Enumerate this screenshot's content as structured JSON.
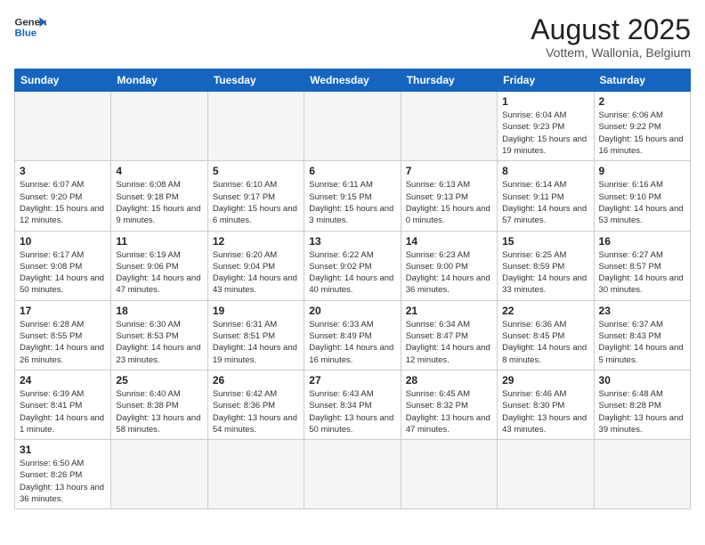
{
  "header": {
    "logo_general": "General",
    "logo_blue": "Blue",
    "title": "August 2025",
    "subtitle": "Vottem, Wallonia, Belgium"
  },
  "weekdays": [
    "Sunday",
    "Monday",
    "Tuesday",
    "Wednesday",
    "Thursday",
    "Friday",
    "Saturday"
  ],
  "weeks": [
    [
      {
        "day": "",
        "info": ""
      },
      {
        "day": "",
        "info": ""
      },
      {
        "day": "",
        "info": ""
      },
      {
        "day": "",
        "info": ""
      },
      {
        "day": "",
        "info": ""
      },
      {
        "day": "1",
        "info": "Sunrise: 6:04 AM\nSunset: 9:23 PM\nDaylight: 15 hours and 19 minutes."
      },
      {
        "day": "2",
        "info": "Sunrise: 6:06 AM\nSunset: 9:22 PM\nDaylight: 15 hours and 16 minutes."
      }
    ],
    [
      {
        "day": "3",
        "info": "Sunrise: 6:07 AM\nSunset: 9:20 PM\nDaylight: 15 hours and 12 minutes."
      },
      {
        "day": "4",
        "info": "Sunrise: 6:08 AM\nSunset: 9:18 PM\nDaylight: 15 hours and 9 minutes."
      },
      {
        "day": "5",
        "info": "Sunrise: 6:10 AM\nSunset: 9:17 PM\nDaylight: 15 hours and 6 minutes."
      },
      {
        "day": "6",
        "info": "Sunrise: 6:11 AM\nSunset: 9:15 PM\nDaylight: 15 hours and 3 minutes."
      },
      {
        "day": "7",
        "info": "Sunrise: 6:13 AM\nSunset: 9:13 PM\nDaylight: 15 hours and 0 minutes."
      },
      {
        "day": "8",
        "info": "Sunrise: 6:14 AM\nSunset: 9:11 PM\nDaylight: 14 hours and 57 minutes."
      },
      {
        "day": "9",
        "info": "Sunrise: 6:16 AM\nSunset: 9:10 PM\nDaylight: 14 hours and 53 minutes."
      }
    ],
    [
      {
        "day": "10",
        "info": "Sunrise: 6:17 AM\nSunset: 9:08 PM\nDaylight: 14 hours and 50 minutes."
      },
      {
        "day": "11",
        "info": "Sunrise: 6:19 AM\nSunset: 9:06 PM\nDaylight: 14 hours and 47 minutes."
      },
      {
        "day": "12",
        "info": "Sunrise: 6:20 AM\nSunset: 9:04 PM\nDaylight: 14 hours and 43 minutes."
      },
      {
        "day": "13",
        "info": "Sunrise: 6:22 AM\nSunset: 9:02 PM\nDaylight: 14 hours and 40 minutes."
      },
      {
        "day": "14",
        "info": "Sunrise: 6:23 AM\nSunset: 9:00 PM\nDaylight: 14 hours and 36 minutes."
      },
      {
        "day": "15",
        "info": "Sunrise: 6:25 AM\nSunset: 8:59 PM\nDaylight: 14 hours and 33 minutes."
      },
      {
        "day": "16",
        "info": "Sunrise: 6:27 AM\nSunset: 8:57 PM\nDaylight: 14 hours and 30 minutes."
      }
    ],
    [
      {
        "day": "17",
        "info": "Sunrise: 6:28 AM\nSunset: 8:55 PM\nDaylight: 14 hours and 26 minutes."
      },
      {
        "day": "18",
        "info": "Sunrise: 6:30 AM\nSunset: 8:53 PM\nDaylight: 14 hours and 23 minutes."
      },
      {
        "day": "19",
        "info": "Sunrise: 6:31 AM\nSunset: 8:51 PM\nDaylight: 14 hours and 19 minutes."
      },
      {
        "day": "20",
        "info": "Sunrise: 6:33 AM\nSunset: 8:49 PM\nDaylight: 14 hours and 16 minutes."
      },
      {
        "day": "21",
        "info": "Sunrise: 6:34 AM\nSunset: 8:47 PM\nDaylight: 14 hours and 12 minutes."
      },
      {
        "day": "22",
        "info": "Sunrise: 6:36 AM\nSunset: 8:45 PM\nDaylight: 14 hours and 8 minutes."
      },
      {
        "day": "23",
        "info": "Sunrise: 6:37 AM\nSunset: 8:43 PM\nDaylight: 14 hours and 5 minutes."
      }
    ],
    [
      {
        "day": "24",
        "info": "Sunrise: 6:39 AM\nSunset: 8:41 PM\nDaylight: 14 hours and 1 minute."
      },
      {
        "day": "25",
        "info": "Sunrise: 6:40 AM\nSunset: 8:38 PM\nDaylight: 13 hours and 58 minutes."
      },
      {
        "day": "26",
        "info": "Sunrise: 6:42 AM\nSunset: 8:36 PM\nDaylight: 13 hours and 54 minutes."
      },
      {
        "day": "27",
        "info": "Sunrise: 6:43 AM\nSunset: 8:34 PM\nDaylight: 13 hours and 50 minutes."
      },
      {
        "day": "28",
        "info": "Sunrise: 6:45 AM\nSunset: 8:32 PM\nDaylight: 13 hours and 47 minutes."
      },
      {
        "day": "29",
        "info": "Sunrise: 6:46 AM\nSunset: 8:30 PM\nDaylight: 13 hours and 43 minutes."
      },
      {
        "day": "30",
        "info": "Sunrise: 6:48 AM\nSunset: 8:28 PM\nDaylight: 13 hours and 39 minutes."
      }
    ],
    [
      {
        "day": "31",
        "info": "Sunrise: 6:50 AM\nSunset: 8:26 PM\nDaylight: 13 hours and 36 minutes."
      },
      {
        "day": "",
        "info": ""
      },
      {
        "day": "",
        "info": ""
      },
      {
        "day": "",
        "info": ""
      },
      {
        "day": "",
        "info": ""
      },
      {
        "day": "",
        "info": ""
      },
      {
        "day": "",
        "info": ""
      }
    ]
  ]
}
